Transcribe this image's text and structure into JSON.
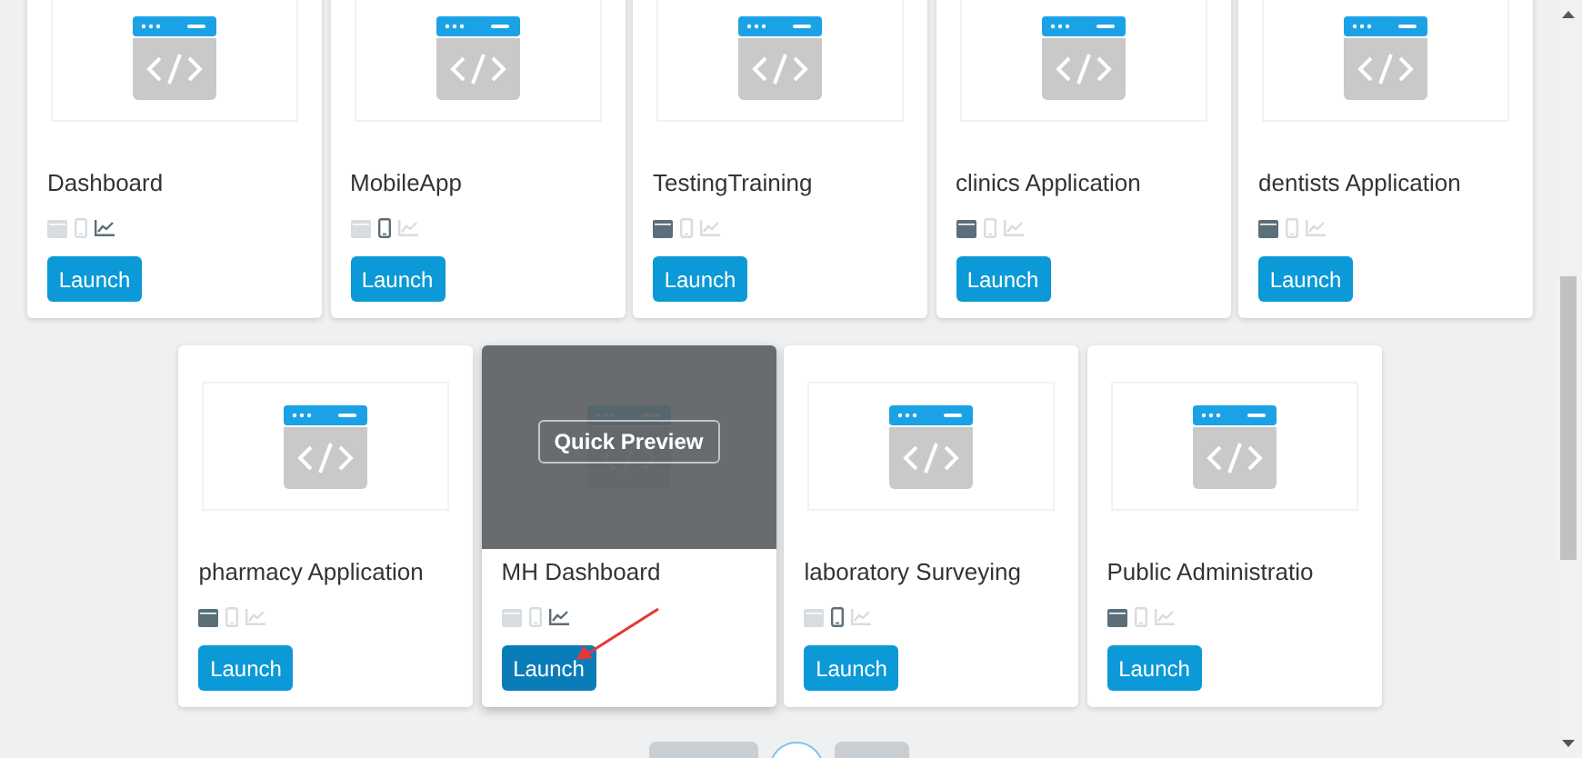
{
  "rows": [
    {
      "apps": [
        {
          "name": "Dashboard",
          "desktop": false,
          "mobile": false,
          "analytics": true,
          "button": "Launch",
          "hovered": false
        },
        {
          "name": "MobileApp",
          "desktop": false,
          "mobile": true,
          "analytics": false,
          "button": "Launch",
          "hovered": false
        },
        {
          "name": "TestingTraining",
          "desktop": true,
          "mobile": false,
          "analytics": false,
          "button": "Launch",
          "hovered": false
        },
        {
          "name": "clinics Application",
          "desktop": true,
          "mobile": false,
          "analytics": false,
          "button": "Launch",
          "hovered": false
        },
        {
          "name": "dentists Application",
          "desktop": true,
          "mobile": false,
          "analytics": false,
          "button": "Launch",
          "hovered": false
        }
      ]
    },
    {
      "apps": [
        {
          "name": "pharmacy Application",
          "desktop": true,
          "mobile": false,
          "analytics": false,
          "button": "Launch",
          "hovered": false
        },
        {
          "name": "MH Dashboard",
          "desktop": false,
          "mobile": false,
          "analytics": true,
          "button": "Launch",
          "hovered": true,
          "overlay_label": "Quick Preview",
          "annotation_arrow": true
        },
        {
          "name": "laboratory Surveying",
          "desktop": false,
          "mobile": true,
          "analytics": false,
          "button": "Launch",
          "hovered": false
        },
        {
          "name": "Public Administratio",
          "desktop": true,
          "mobile": false,
          "analytics": false,
          "button": "Launch",
          "hovered": false
        }
      ]
    }
  ]
}
